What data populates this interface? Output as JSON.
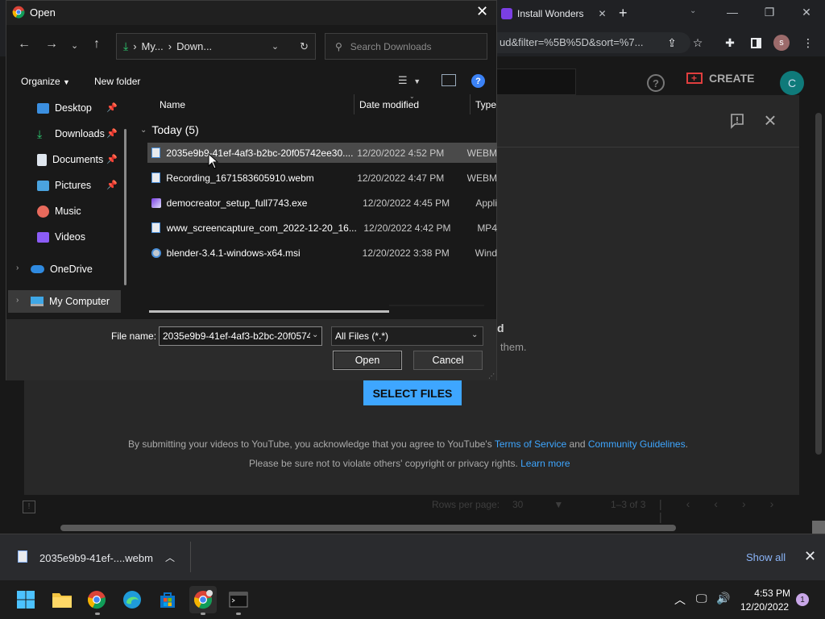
{
  "browser": {
    "tab_label": "Install Wonders",
    "omnibox_text": "ud&filter=%5B%5D&sort=%7...",
    "window_min": "—",
    "window_restore": "❐",
    "window_close": "✕"
  },
  "youtube": {
    "create_label": "CREATE",
    "avatar_letter": "C",
    "upload_title_fragment": "d",
    "upload_sub_fragment": "them.",
    "select_files": "SELECT FILES",
    "legal_line1_prefix": "By submitting your videos to YouTube, you acknowledge that you agree to YouTube's ",
    "terms_link": "Terms of Service",
    "legal_and": " and ",
    "guidelines_link": "Community Guidelines",
    "legal_period": ".",
    "legal_line2_prefix": "Please be sure not to violate others' copyright or privacy rights. ",
    "learn_more": "Learn more",
    "rows_per_page_label": "Rows per page:",
    "rows_per_page_value": "30",
    "pager_count": "1–3 of 3"
  },
  "download_bar": {
    "file_name": "2035e9b9-41ef-....webm",
    "show_all": "Show all"
  },
  "taskbar": {
    "time": "4:53 PM",
    "date": "12/20/2022",
    "notifications": "1"
  },
  "dialog": {
    "title": "Open",
    "breadcrumb_1": "My...",
    "breadcrumb_sep": "›",
    "breadcrumb_2": "Down...",
    "search_placeholder": "Search Downloads",
    "organize": "Organize",
    "new_folder": "New folder",
    "help": "?",
    "nav_items": [
      {
        "label": "Desktop",
        "pinned": true
      },
      {
        "label": "Downloads",
        "pinned": true
      },
      {
        "label": "Documents",
        "pinned": true
      },
      {
        "label": "Pictures",
        "pinned": true
      },
      {
        "label": "Music",
        "pinned": false
      },
      {
        "label": "Videos",
        "pinned": false
      }
    ],
    "onedrive": "OneDrive",
    "my_computer": "My Computer",
    "columns": {
      "name": "Name",
      "date": "Date modified",
      "type": "Type"
    },
    "group_header": "Today (5)",
    "files": [
      {
        "name": "2035e9b9-41ef-4af3-b2bc-20f05742ee30....",
        "date": "12/20/2022 4:52 PM",
        "type": "WEBM"
      },
      {
        "name": "Recording_1671583605910.webm",
        "date": "12/20/2022 4:47 PM",
        "type": "WEBM"
      },
      {
        "name": "democreator_setup_full7743.exe",
        "date": "12/20/2022 4:45 PM",
        "type": "Appli"
      },
      {
        "name": "www_screencapture_com_2022-12-20_16...",
        "date": "12/20/2022 4:42 PM",
        "type": "MP4"
      },
      {
        "name": "blender-3.4.1-windows-x64.msi",
        "date": "12/20/2022 3:38 PM",
        "type": "Wind"
      }
    ],
    "file_name_label": "File name:",
    "file_name_value": "2035e9b9-41ef-4af3-b2bc-20f0574",
    "file_type_value": "All Files (*.*)",
    "open_button": "Open",
    "cancel_button": "Cancel"
  },
  "colors": {
    "accent_blue": "#3ea6ff",
    "dialog_bg": "#191919",
    "selection": "#4a4a4a"
  }
}
